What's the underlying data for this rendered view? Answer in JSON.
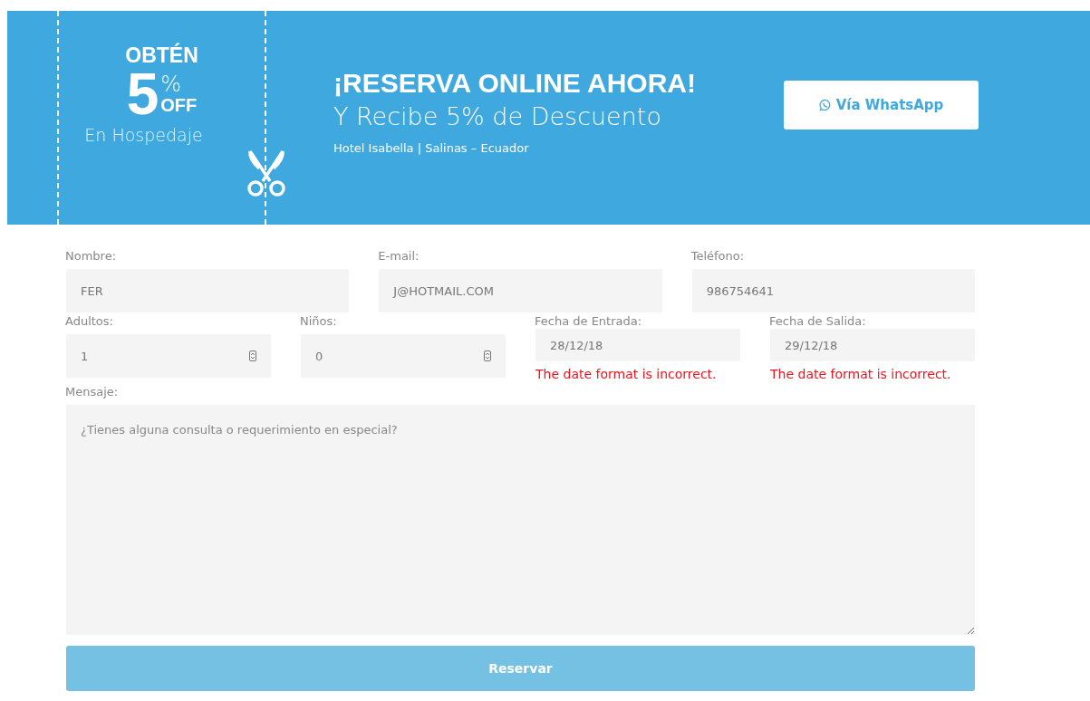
{
  "banner": {
    "coupon": {
      "top": "OBTÉN",
      "amount": "5",
      "percent": "%",
      "off": "OFF",
      "subtitle": "En Hospedaje"
    },
    "headline": "¡RESERVA ONLINE AHORA!",
    "subheadline": "Y Recibe 5% de Descuento",
    "location": "Hotel Isabella | Salinas – Ecuador",
    "whatsapp_button": "Vía WhatsApp"
  },
  "form": {
    "rows": [
      [
        {
          "label": "Nombre:",
          "kind": "text",
          "value": "FER"
        },
        {
          "label": "E-mail:",
          "kind": "text",
          "value": "J@HOTMAIL.COM"
        },
        {
          "label": "Teléfono:",
          "kind": "text",
          "value": "986754641"
        }
      ],
      [
        {
          "label": "Adultos:",
          "kind": "number",
          "value": "1"
        },
        {
          "label": "Niños:",
          "kind": "number",
          "value": "0"
        },
        {
          "label": "Fecha de Entrada:",
          "kind": "date",
          "value": "28/12/18",
          "error": "The date format is incorrect."
        },
        {
          "label": "Fecha de Salida:",
          "kind": "date",
          "value": "29/12/18",
          "error": "The date format is incorrect."
        }
      ]
    ],
    "message": {
      "label": "Mensaje:",
      "placeholder": "¿Tienes alguna consulta o requerimiento en especial?"
    },
    "submit_button": "Reservar"
  }
}
